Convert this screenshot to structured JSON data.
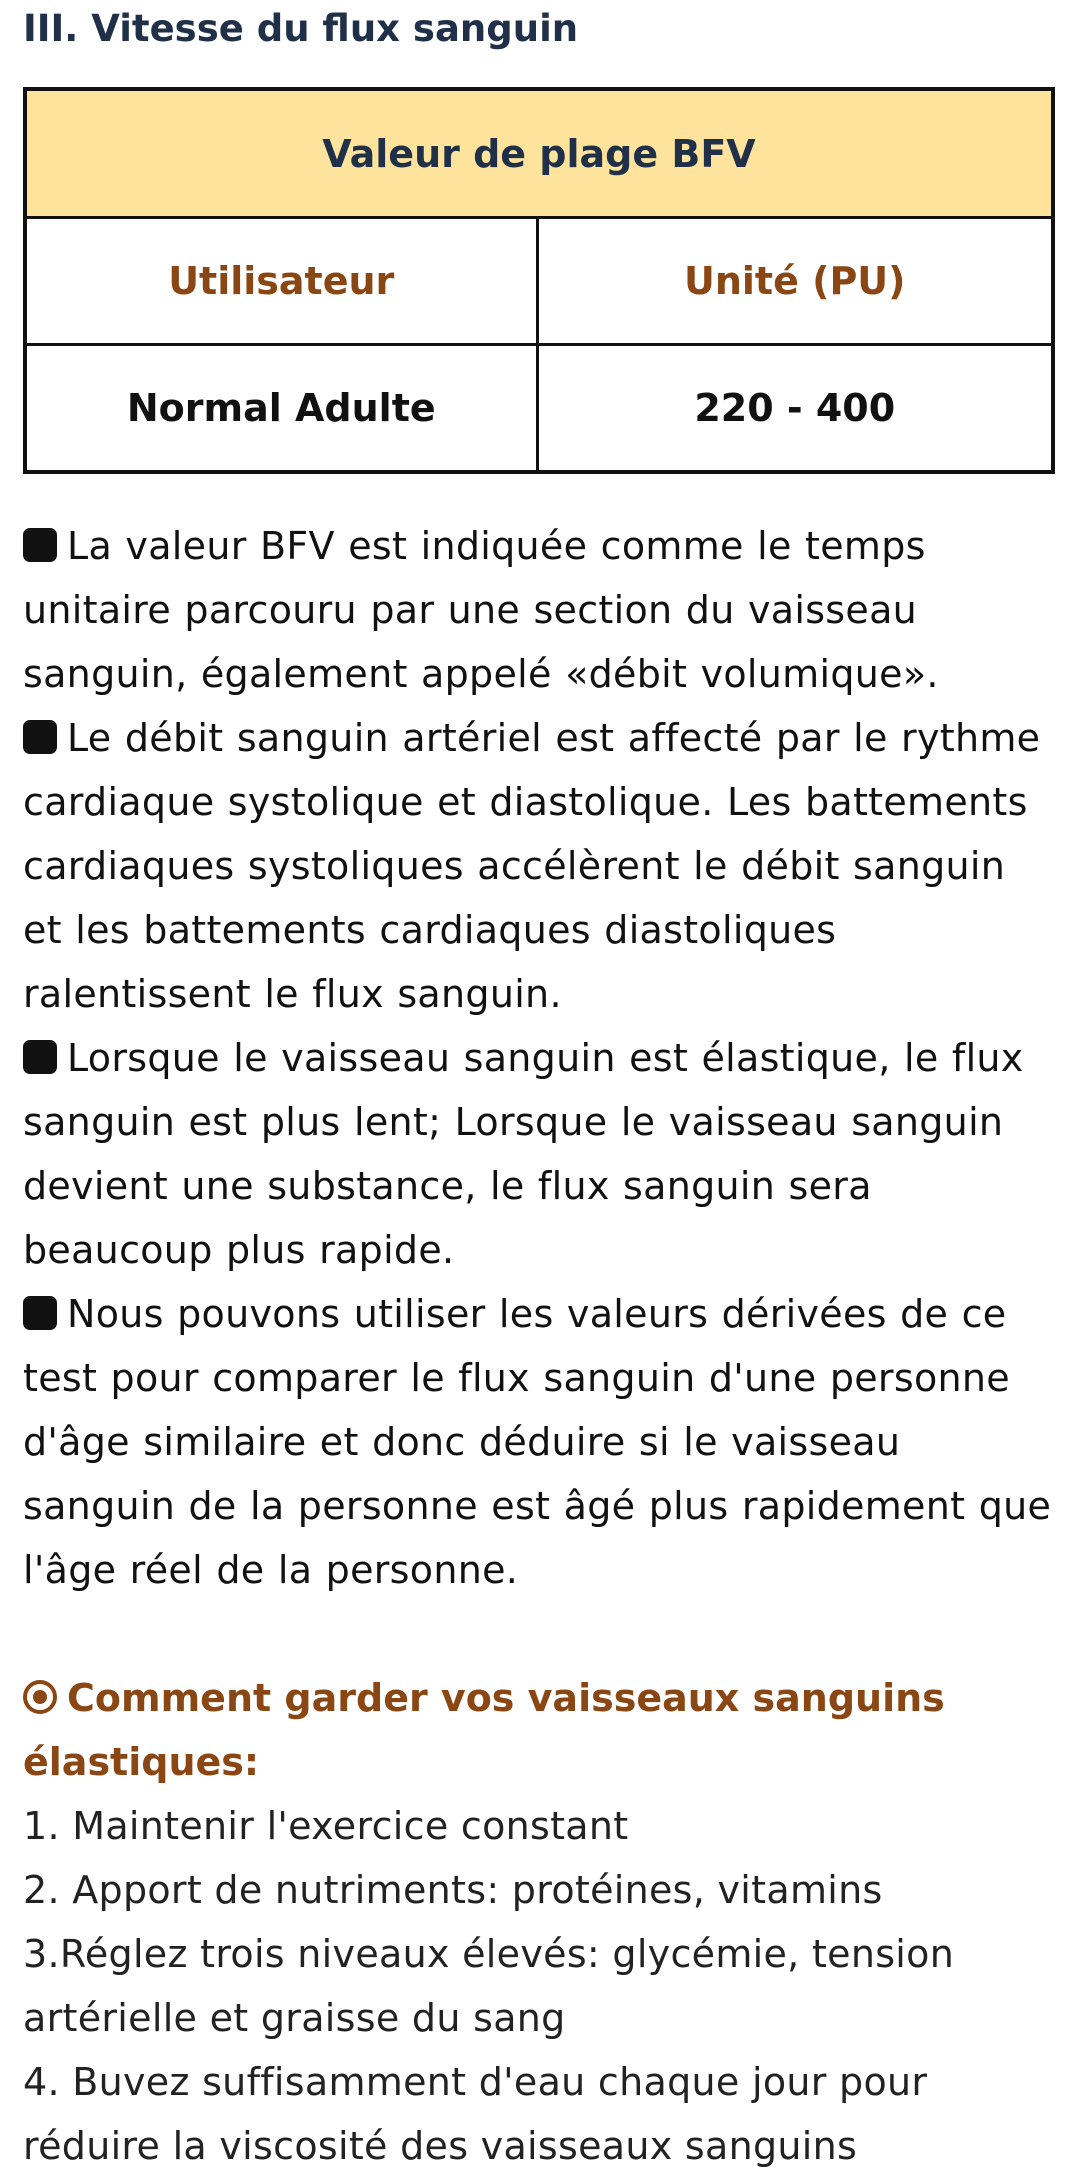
{
  "section": {
    "title": "III. Vitesse du flux sanguin"
  },
  "table": {
    "caption": "Valeur de plage BFV",
    "headers": [
      "Utilisateur",
      "Unité (PU)"
    ],
    "rows": [
      [
        "Normal Adulte",
        "220 - 400"
      ]
    ]
  },
  "bullets": [
    "La valeur BFV est indiquée comme le temps unitaire parcouru par une section du vaisseau sanguin, également appelé «débit volumique».",
    "Le débit sanguin artériel est affecté par le rythme cardiaque systolique et diastolique. Les battements cardiaques systoliques accélèrent le débit sanguin et les battements cardiaques diastoliques ralentissent le flux sanguin.",
    "Lorsque le vaisseau sanguin est élastique, le flux sanguin est plus lent; Lorsque le vaisseau sanguin devient une substance, le flux sanguin sera beaucoup plus rapide.",
    "Nous pouvons utiliser les valeurs dérivées de ce test pour comparer le flux sanguin d'une personne d'âge similaire et donc déduire si le vaisseau sanguin de la personne est âgé plus rapidement que l'âge réel de la personne."
  ],
  "tips": {
    "title": "Comment garder vos vaisseaux sanguins élastiques:",
    "items": [
      "1. Maintenir l'exercice constant",
      "2. Apport de nutriments: protéines, vitamins",
      "3.Réglez trois niveaux élevés: glycémie, tension artérielle et graisse du sang",
      "4. Buvez suffisamment d'eau chaque jour pour réduire la viscosité des vaisseaux sanguins"
    ]
  },
  "colors": {
    "title": "#1f3048",
    "accent": "#8a4713",
    "table_header_bg": "#fde39b",
    "text": "#111111"
  },
  "icons": {
    "bullet": "black-square-icon",
    "tips": "target-icon"
  }
}
